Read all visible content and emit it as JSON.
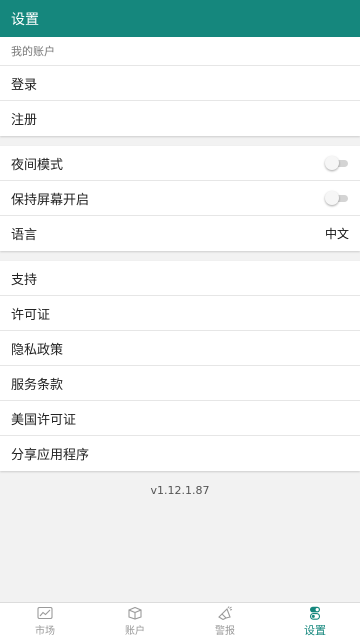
{
  "header": {
    "title": "设置"
  },
  "account": {
    "section_title": "我的账户",
    "items": [
      {
        "label": "登录"
      },
      {
        "label": "注册"
      }
    ]
  },
  "display": {
    "night_mode": {
      "label": "夜间模式",
      "on": false
    },
    "keep_screen_on": {
      "label": "保持屏幕开启",
      "on": false
    },
    "language": {
      "label": "语言",
      "value": "中文"
    }
  },
  "about": {
    "items": [
      {
        "label": "支持"
      },
      {
        "label": "许可证"
      },
      {
        "label": "隐私政策"
      },
      {
        "label": "服务条款"
      },
      {
        "label": "美国许可证"
      },
      {
        "label": "分享应用程序"
      }
    ]
  },
  "version": "v1.12.1.87",
  "bottom_nav": {
    "active": "settings",
    "items": [
      {
        "id": "market",
        "label": "市场",
        "icon": "market-chart-icon"
      },
      {
        "id": "account",
        "label": "账户",
        "icon": "account-box-icon"
      },
      {
        "id": "alerts",
        "label": "警报",
        "icon": "alert-megaphone-icon"
      },
      {
        "id": "settings",
        "label": "设置",
        "icon": "settings-toggle-icon"
      }
    ]
  },
  "colors": {
    "primary": "#15877d",
    "background": "#f2f2f2",
    "inactive": "#9a9a9a"
  }
}
